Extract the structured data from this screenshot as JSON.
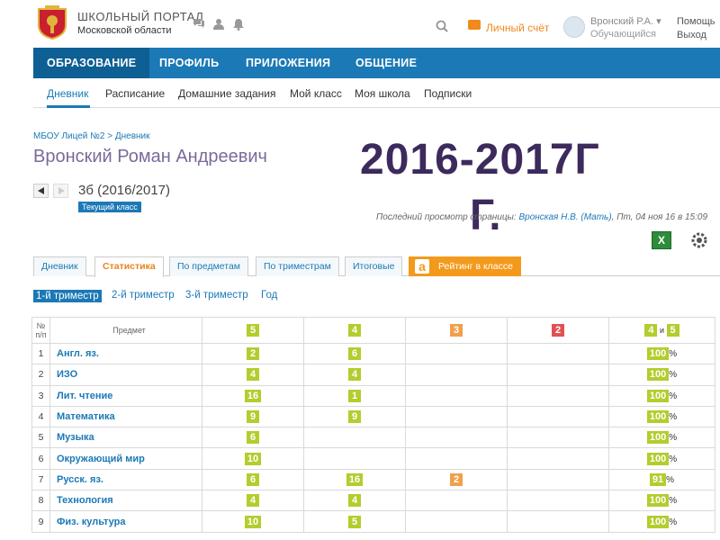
{
  "header": {
    "portal_title": "ШКОЛЬНЫЙ ПОРТАЛ",
    "portal_subtitle": "Московской области",
    "account_label": "Личный счёт",
    "user_name": "Вронский Р.А. ▾",
    "user_role": "Обучающийся",
    "help": "Помощь",
    "logout": "Выход"
  },
  "main_nav": [
    "ОБРАЗОВАНИЕ",
    "ПРОФИЛЬ",
    "ПРИЛОЖЕНИЯ",
    "ОБЩЕНИЕ"
  ],
  "sub_nav": [
    "Дневник",
    "Расписание",
    "Домашние задания",
    "Мой класс",
    "Моя школа",
    "Подписки"
  ],
  "breadcrumb": "МБОУ Лицей №2 > Дневник",
  "student_name": "Вронский Роман Андреевич",
  "class_label": "3б (2016/2017)",
  "current_class_badge": "Текущий класс",
  "overlay_year_line1": "2016-2017Г",
  "overlay_year_line2": "Г.",
  "last_view": {
    "prefix": "Последний просмотр страницы: ",
    "name": "Вронская Н.В. (Мать)",
    "suffix": ", Пт, 04 ноя 16 в 15:09"
  },
  "excel_icon_text": "X",
  "page_tabs": [
    "Дневник",
    "Статистика",
    "По предметам",
    "По триместрам",
    "Итоговые",
    "Рейтинг в классе"
  ],
  "rating_icon_text": "a",
  "trimesters": [
    "1-й триместр",
    "2-й триместр",
    "3-й триместр",
    "Год"
  ],
  "table": {
    "header_num": "№ п/п",
    "header_subject": "Предмет",
    "grade_headers": [
      "5",
      "4",
      "3",
      "2"
    ],
    "quality_header": {
      "a": "4",
      "and": "и",
      "b": "5"
    },
    "rows": [
      {
        "n": "1",
        "subject": "Англ. яз.",
        "g5": "2",
        "g4": "6",
        "g3": "",
        "g2": "",
        "pct": "100"
      },
      {
        "n": "2",
        "subject": "ИЗО",
        "g5": "4",
        "g4": "4",
        "g3": "",
        "g2": "",
        "pct": "100"
      },
      {
        "n": "3",
        "subject": "Лит. чтение",
        "g5": "16",
        "g4": "1",
        "g3": "",
        "g2": "",
        "pct": "100"
      },
      {
        "n": "4",
        "subject": "Математика",
        "g5": "9",
        "g4": "9",
        "g3": "",
        "g2": "",
        "pct": "100"
      },
      {
        "n": "5",
        "subject": "Музыка",
        "g5": "6",
        "g4": "",
        "g3": "",
        "g2": "",
        "pct": "100"
      },
      {
        "n": "6",
        "subject": "Окружающий мир",
        "g5": "10",
        "g4": "",
        "g3": "",
        "g2": "",
        "pct": "100"
      },
      {
        "n": "7",
        "subject": "Русск. яз.",
        "g5": "6",
        "g4": "16",
        "g3": "2",
        "g2": "",
        "pct": "91"
      },
      {
        "n": "8",
        "subject": "Технология",
        "g5": "4",
        "g4": "4",
        "g3": "",
        "g2": "",
        "pct": "100"
      },
      {
        "n": "9",
        "subject": "Физ. культура",
        "g5": "10",
        "g4": "5",
        "g3": "",
        "g2": "",
        "pct": "100"
      }
    ],
    "pct_sign": "%"
  },
  "colors": {
    "nav_blue": "#1b79b6",
    "grade_green": "#b5cc2e",
    "grade_orange": "#f0a04b",
    "grade_red": "#e05252",
    "title_purple": "#3d2a5c"
  }
}
